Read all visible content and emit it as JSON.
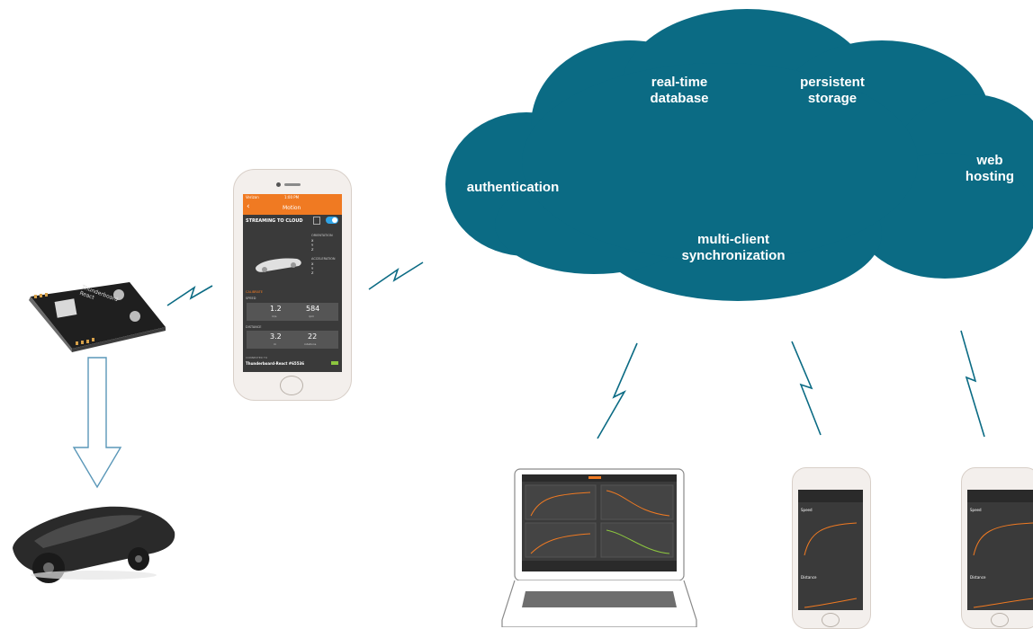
{
  "cloud": {
    "services": [
      {
        "label": "authentication"
      },
      {
        "label": "real-time database"
      },
      {
        "label": "persistent storage"
      },
      {
        "label": "web hosting"
      },
      {
        "label": "multi-client synchronization"
      }
    ],
    "color": "#0b6b84"
  },
  "phone_app": {
    "status_left": "Verizon",
    "status_time": "1:00 PM",
    "nav_title": "Motion",
    "stream_label": "STREAMING TO CLOUD",
    "orientation_label": "ORIENTATION",
    "acceleration_label": "ACCELERATION",
    "axis_labels": [
      "X",
      "Y",
      "Z"
    ],
    "calibrate_label": "CALIBRATE",
    "speed_label": "SPEED",
    "speed_value": "1.2",
    "speed_unit": "m/s",
    "rpm_value": "584",
    "rpm_unit": "rpm",
    "distance_label": "DISTANCE",
    "distance_value": "3.2",
    "distance_unit": "m",
    "rotations_value": "22",
    "rotations_unit": "rotations",
    "connected_label": "CONNECTED TO",
    "device_name": "Thunderboard-React #65536",
    "accent": "#f07a22"
  },
  "board": {
    "label": "Thunderboard React"
  },
  "client_phone": {
    "speed_label": "Speed",
    "distance_label": "Distance"
  }
}
